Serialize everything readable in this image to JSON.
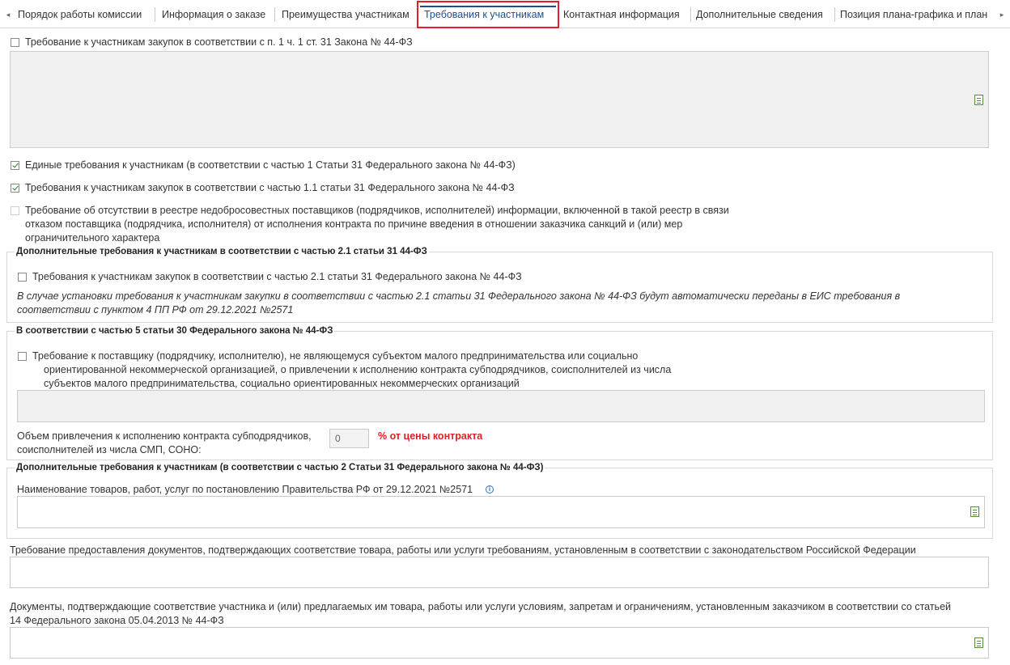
{
  "tabs": [
    {
      "label": "Порядок работы комиссии"
    },
    {
      "label": "Информация о заказе"
    },
    {
      "label": "Преимущества участникам"
    },
    {
      "label": "Требования к участникам"
    },
    {
      "label": "Контактная информация"
    },
    {
      "label": "Дополнительные сведения"
    },
    {
      "label": "Позиция плана-графика и план"
    }
  ],
  "tab_arrows": {
    "left": "◂",
    "right": "▸"
  },
  "req_31_1": {
    "label": "Требование к участникам закупок в соответствии с п. 1 ч. 1 ст. 31 Закона № 44-ФЗ",
    "checked": false
  },
  "unified": {
    "label": "Единые требования к участникам (в соответствии с частью 1 Статьи 31 Федерального закона № 44-ФЗ)",
    "checked": true
  },
  "req_31_1_1": {
    "label": "Требования к участникам закупок в соответствии с частью 1.1 статьи 31 Федерального закона № 44-ФЗ",
    "checked": true
  },
  "registry": {
    "line1": "Требование об отсутствии в реестре недобросовестных поставщиков (подрядчиков, исполнителей) информации, включенной в такой реестр в связи",
    "line2": "отказом поставщика (подрядчика, исполнителя) от исполнения контракта по причине введения в отношении заказчика санкций и (или) мер",
    "line3": "ограничительного характера",
    "checked": false
  },
  "section_2_1": {
    "legend": "Дополнительные требования к участникам в соответствии с частью 2.1 статьи 31 44-ФЗ",
    "checkbox_label": "Требования к участникам закупок в соответствии с частью 2.1 статьи 31 Федерального закона № 44-ФЗ",
    "note_line1": "В случае установки требования к участникам закупки в соответствии с частью 2.1 статьи 31 Федерального закона № 44-ФЗ будут автоматически переданы в ЕИС требования в",
    "note_line2": "соответствии с пунктом 4 ПП РФ от 29.12.2021 №2571"
  },
  "section_30_5": {
    "legend": "В соответствии с частью 5 статьи 30 Федерального закона № 44-ФЗ",
    "line1": "Требование к поставщику (подрядчику, исполнителю), не являющемуся субъектом малого предпринимательства или социально",
    "line2": "ориентированной некоммерческой организацией, о привлечении к исполнению контракта субподрядчиков, соисполнителей из числа",
    "line3": "субъектов малого предпринимательства, социально ориентированных некоммерческих организаций",
    "volume_line1": "Объем привлечения к исполнению контракта субподрядчиков,",
    "volume_line2": "соисполнителей из числа СМП, СОНО:",
    "volume_value": "0",
    "percent_label": "% от цены контракта"
  },
  "section_2": {
    "legend": "Дополнительные требования к участникам (в соответствии с частью 2 Статьи 31 Федерального закона № 44-ФЗ)",
    "goods_label": "Наименование товаров, работ, услуг по постановлению Правительства РФ от 29.12.2021 №2571",
    "info_icon": "i"
  },
  "docs_req_label": "Требование предоставления документов, подтверждающих соответствие товара, работы или услуги требованиям, установленным в соответствии с законодательством Российской Федерации",
  "docs_conf_line1": "Документы, подтверждающие соответствие участника и (или) предлагаемых им товара, работы или услуги условиям, запретам и ограничениям, установленным заказчиком в соответствии со статьей",
  "docs_conf_line2": "14 Федерального закона 05.04.2013 № 44-ФЗ",
  "colors": {
    "accent": "#1f4f8a",
    "highlight": "#e01f26",
    "check": "#2e7d32"
  }
}
